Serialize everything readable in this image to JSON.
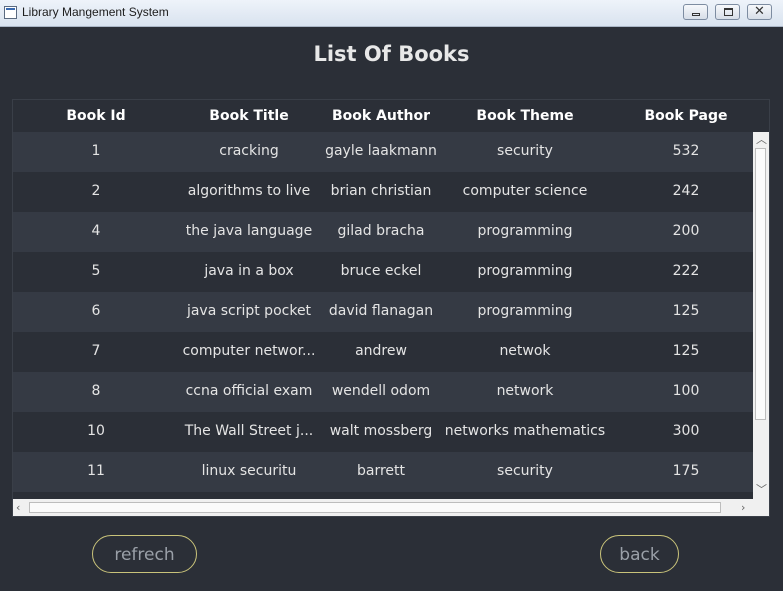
{
  "window": {
    "title": "Library Mangement System"
  },
  "page": {
    "title": "List Of Books"
  },
  "table": {
    "columns": [
      "Book Id",
      "Book Title",
      "Book Author",
      "Book Theme",
      "Book Page"
    ],
    "rows": [
      [
        "1",
        "cracking",
        "gayle laakmann",
        "security",
        "532"
      ],
      [
        "2",
        "algorithms to live",
        "brian christian",
        "computer science",
        "242"
      ],
      [
        "4",
        "the java language",
        "gilad bracha",
        "programming",
        "200"
      ],
      [
        "5",
        "java in a box",
        "bruce eckel",
        "programming",
        "222"
      ],
      [
        "6",
        "java script pocket",
        "david flanagan",
        "programming",
        "125"
      ],
      [
        "7",
        "computer networ...",
        "andrew",
        "netwok",
        "125"
      ],
      [
        "8",
        "ccna official exam",
        "wendell odom",
        "network",
        "100"
      ],
      [
        "10",
        "The Wall Street j...",
        "walt mossberg",
        "networks mathematics",
        "300"
      ],
      [
        "11",
        "linux securitu",
        "barrett",
        "security",
        "175"
      ]
    ]
  },
  "buttons": {
    "refresh": "refrech",
    "back": "back"
  },
  "icons": {
    "app": "app-window-icon",
    "minimize": "minimize-icon",
    "maximize": "maximize-icon",
    "close": "close-icon"
  },
  "colors": {
    "background": "#2b2f37",
    "row_alt": "#353a44",
    "button_border": "#c9c37a",
    "button_text": "#9aa0a8"
  }
}
